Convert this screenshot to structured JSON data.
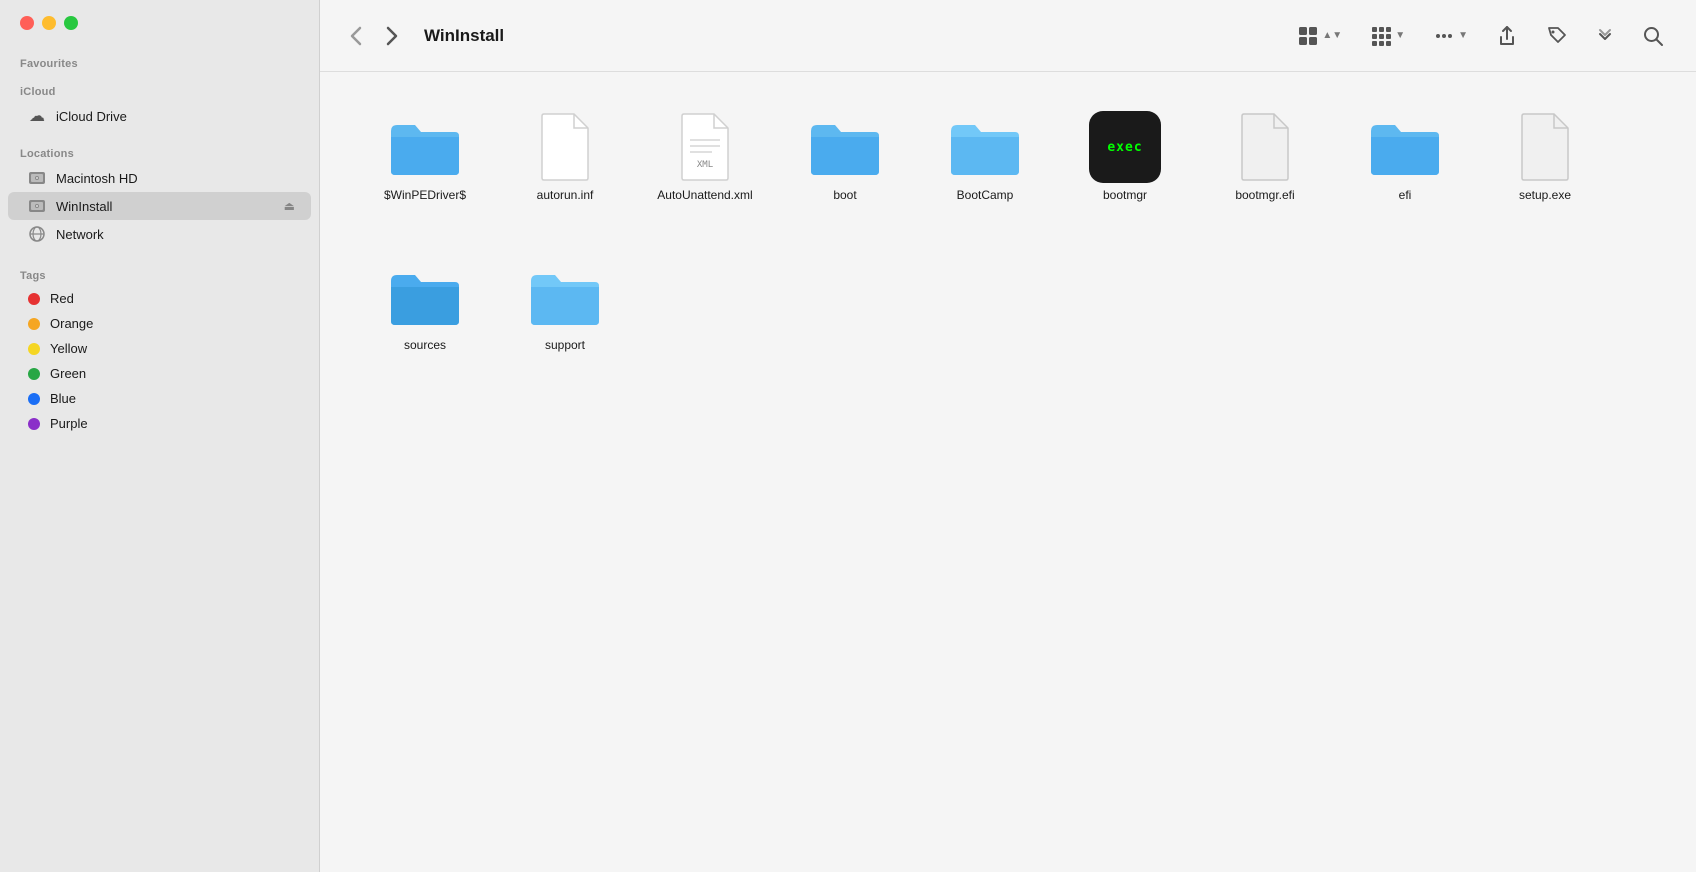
{
  "window": {
    "title": "WinInstall"
  },
  "controls": {
    "close": "close",
    "minimize": "minimize",
    "maximize": "maximize"
  },
  "sidebar": {
    "favourites_label": "Favourites",
    "icloud_label": "iCloud",
    "icloud_drive": "iCloud Drive",
    "locations_label": "Locations",
    "locations": [
      {
        "id": "macintosh-hd",
        "label": "Macintosh HD",
        "icon": "disk"
      },
      {
        "id": "wininstall",
        "label": "WinInstall",
        "icon": "disk",
        "active": true,
        "eject": true
      },
      {
        "id": "network",
        "label": "Network",
        "icon": "network"
      }
    ],
    "tags_label": "Tags",
    "tags": [
      {
        "id": "red",
        "label": "Red",
        "color": "#e63232"
      },
      {
        "id": "orange",
        "label": "Orange",
        "color": "#f5a623"
      },
      {
        "id": "yellow",
        "label": "Yellow",
        "color": "#f5d623"
      },
      {
        "id": "green",
        "label": "Green",
        "color": "#28a745"
      },
      {
        "id": "blue",
        "label": "Blue",
        "color": "#1a6ef5"
      },
      {
        "id": "purple",
        "label": "Purple",
        "color": "#8b2fc9"
      }
    ]
  },
  "toolbar": {
    "back_label": "‹",
    "forward_label": "›",
    "title": "WinInstall",
    "view_grid_label": "⊞",
    "view_options_label": "⊞",
    "more_label": "•••",
    "share_label": "↑",
    "tag_label": "🏷",
    "overflow_label": "»",
    "search_label": "⌕"
  },
  "files": [
    {
      "id": "winpedriver",
      "name": "$WinPEDriver$",
      "type": "folder"
    },
    {
      "id": "autorun-inf",
      "name": "autorun.inf",
      "type": "doc"
    },
    {
      "id": "autounattend-xml",
      "name": "AutoUnattend.xml",
      "type": "xml"
    },
    {
      "id": "boot",
      "name": "boot",
      "type": "folder"
    },
    {
      "id": "bootcamp",
      "name": "BootCamp",
      "type": "folder-light"
    },
    {
      "id": "bootmgr",
      "name": "bootmgr",
      "type": "exec"
    },
    {
      "id": "bootmgr-efi",
      "name": "bootmgr.efi",
      "type": "doc-gray"
    },
    {
      "id": "efi",
      "name": "efi",
      "type": "folder"
    },
    {
      "id": "setup-exe",
      "name": "setup.exe",
      "type": "doc-gray"
    },
    {
      "id": "sources",
      "name": "sources",
      "type": "folder-dark"
    },
    {
      "id": "support",
      "name": "support",
      "type": "folder-light"
    }
  ]
}
